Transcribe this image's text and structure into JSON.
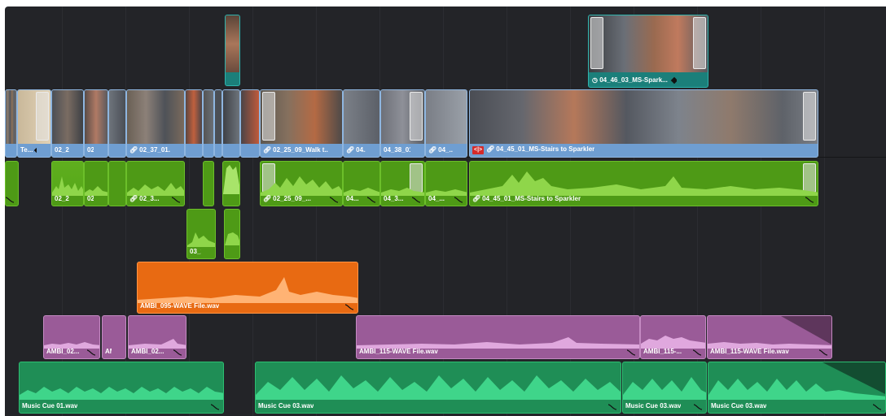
{
  "colors": {
    "video_clip": "#6f9ed1",
    "audio_clip_green": "#4e9a16",
    "audio_clip_orange": "#e86a12",
    "audio_clip_purple": "#9a5b98",
    "audio_clip_teal": "#1f8e56",
    "timeline_bg": "#232428"
  },
  "video_track_v2": {
    "clips": [
      {
        "label": "04_46_03_MS-Spark..."
      }
    ]
  },
  "video_track_v1": {
    "clips": [
      {
        "label": "Te..."
      },
      {
        "label": "02_25..."
      },
      {
        "label": "02..."
      },
      {
        "label": "02_37_01..."
      },
      {
        "label": "02_25_09_Walk t..."
      },
      {
        "label": "04..."
      },
      {
        "label": "04_38_01..."
      },
      {
        "label": "04_..."
      },
      {
        "label": "04_45_01_MS-Stairs to Sparkler"
      }
    ]
  },
  "audio_track_a1": {
    "clips": [
      {
        "label": "02_25..."
      },
      {
        "label": "02..."
      },
      {
        "label": "02_3..."
      },
      {
        "label": "02_25_09_..."
      },
      {
        "label": "04..."
      },
      {
        "label": "04_3..."
      },
      {
        "label": "04_..."
      },
      {
        "label": "04_45_01_MS-Stairs to Sparkler"
      }
    ]
  },
  "audio_track_a2": {
    "clips": [
      {
        "label": "03_1..."
      }
    ]
  },
  "audio_track_a3": {
    "clips": [
      {
        "label": "AMBI_095-WAVE File.wav"
      }
    ]
  },
  "audio_track_a4": {
    "clips": [
      {
        "label": "AMBI_02..."
      },
      {
        "label": "AM..."
      },
      {
        "label": "AMBI_02..."
      },
      {
        "label": "AMBI_115-WAVE File.wav"
      },
      {
        "label": "AMBI_115-..."
      },
      {
        "label": "AMBI_115-WAVE File.wav"
      }
    ]
  },
  "audio_track_a5": {
    "clips": [
      {
        "label": "Music Cue 01.wav"
      },
      {
        "label": "Music Cue 03.wav"
      },
      {
        "label": "Music Cue 03.wav"
      },
      {
        "label": "Music Cue 03.wav"
      }
    ]
  }
}
